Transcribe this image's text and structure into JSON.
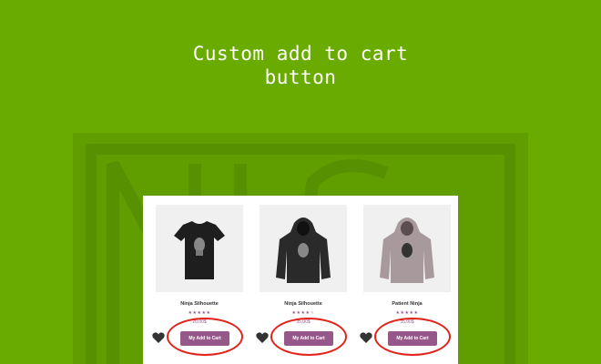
{
  "banner": {
    "title_line1": "Custom add to cart",
    "title_line2": "button"
  },
  "colors": {
    "background": "#6aab00",
    "button": "#96588a",
    "highlight_circle": "#e2231a"
  },
  "products": [
    {
      "name": "Ninja Silhouette",
      "price": "20,00$",
      "rating_stars": 5,
      "button_label": "My Add to Cart",
      "image": "black-tshirt"
    },
    {
      "name": "Ninja Silhouette",
      "price": "35,00$",
      "rating_stars": 4,
      "button_label": "My Add to Cart",
      "image": "black-hoodie"
    },
    {
      "name": "Patient Ninja",
      "price": "35,00$",
      "rating_stars": 5,
      "button_label": "My Add to Cart",
      "image": "grey-hoodie"
    }
  ],
  "icons": {
    "wishlist": "heart-icon"
  }
}
